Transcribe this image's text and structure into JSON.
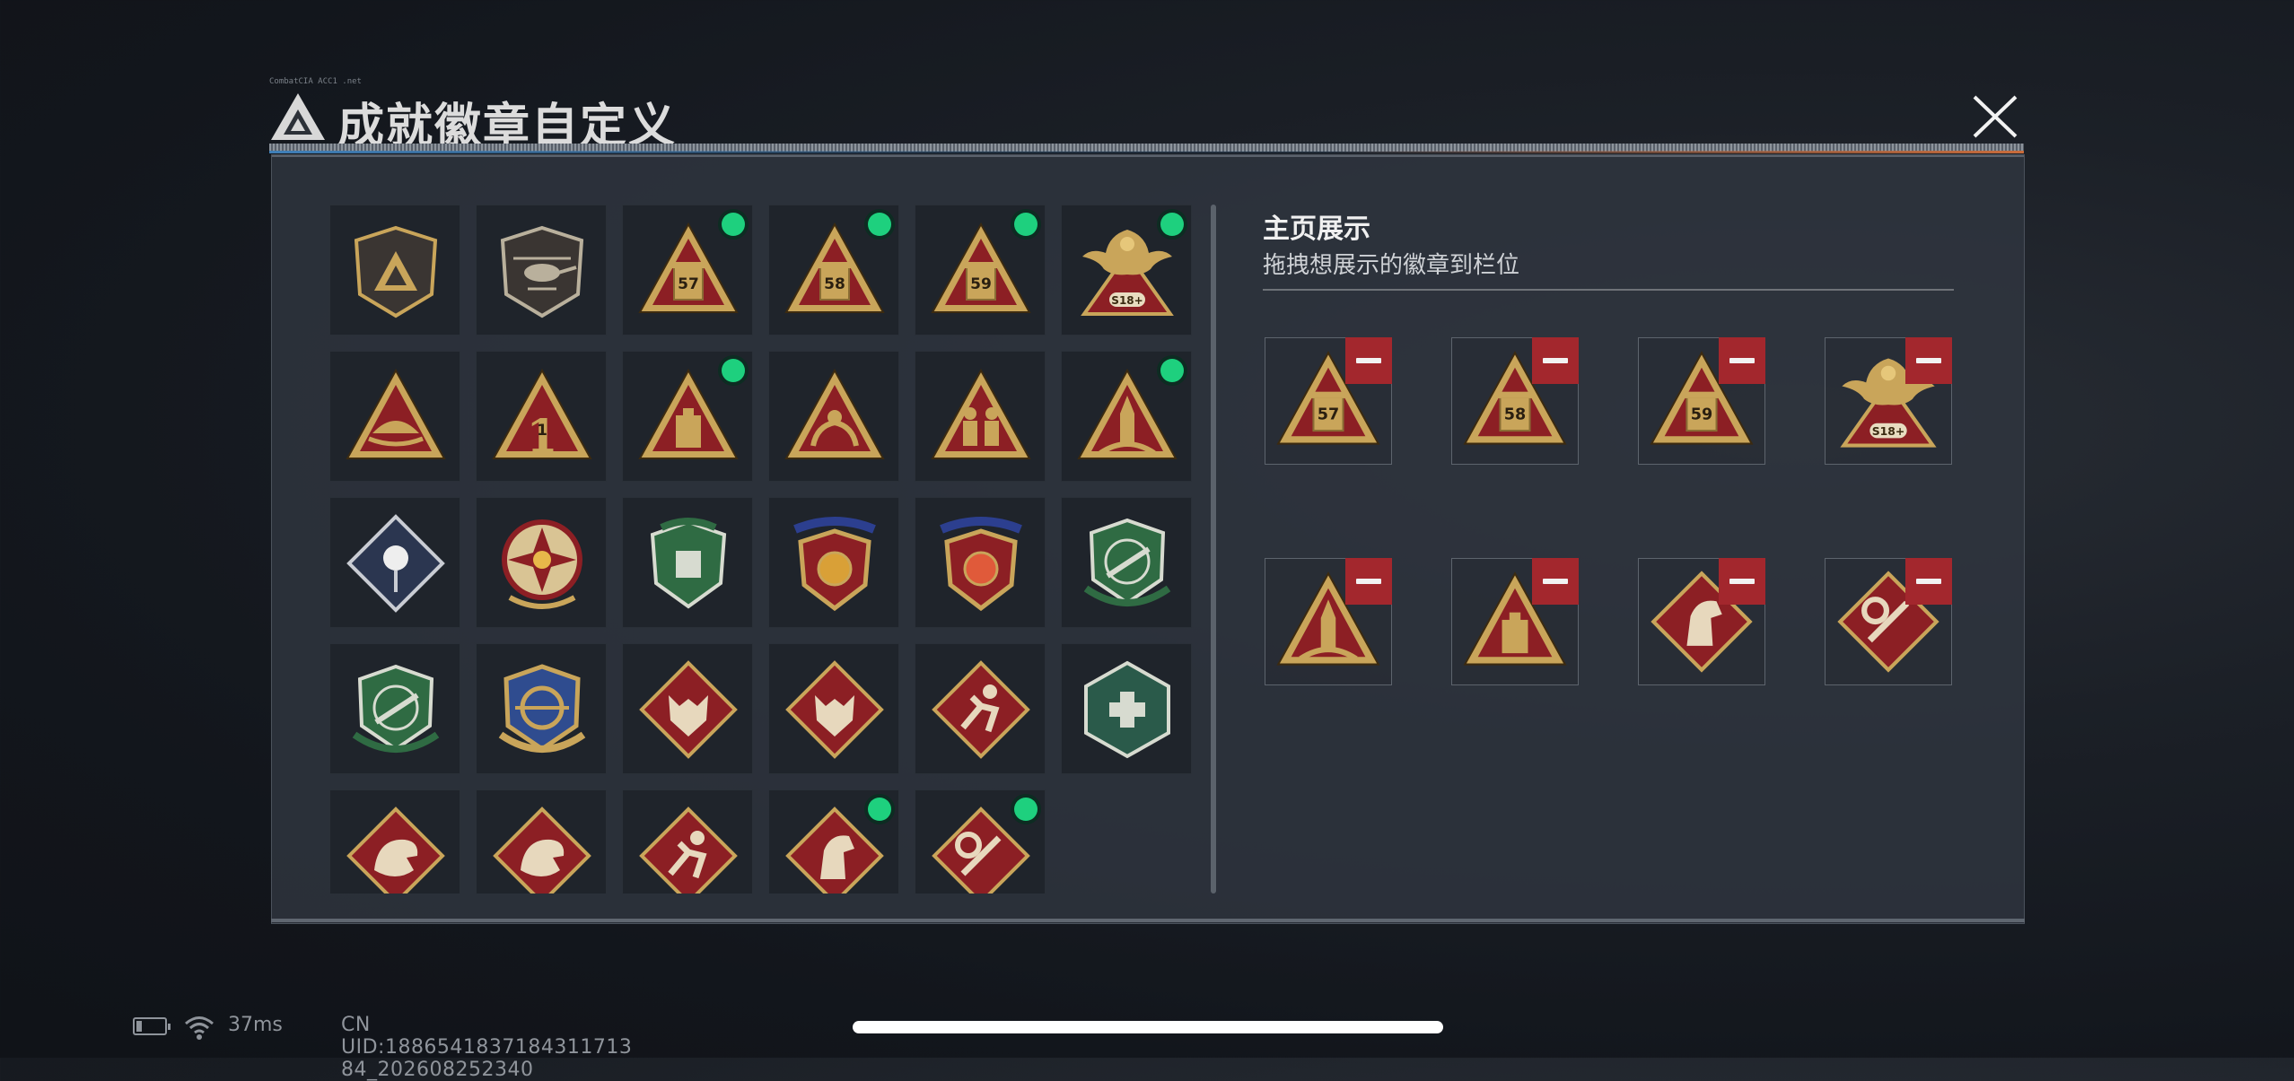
{
  "window": {
    "title": "成就徽章自定义",
    "tiny_caption": "CombatCIA ACC1 .net"
  },
  "showcase": {
    "heading": "主页展示",
    "subtitle": "拖拽想展示的徽章到栏位"
  },
  "colors": {
    "accent_green": "#1ed07e",
    "remove_red": "#a3272d",
    "gold": "#c9a55a",
    "crimson": "#8c1f24"
  },
  "badges": [
    {
      "icon": "shield-logo-icon",
      "new": false
    },
    {
      "icon": "helicopter-shield-icon",
      "new": false
    },
    {
      "icon": "tri-57-icon",
      "new": true,
      "label": "57"
    },
    {
      "icon": "tri-58-icon",
      "new": true,
      "label": "58"
    },
    {
      "icon": "tri-59-icon",
      "new": true,
      "label": "59"
    },
    {
      "icon": "phoenix-s18-icon",
      "new": true,
      "label": "S18+"
    },
    {
      "icon": "tri-helmet-icon",
      "new": false
    },
    {
      "icon": "tri-number-one-icon",
      "new": false,
      "label": "1"
    },
    {
      "icon": "tri-box-icon",
      "new": true
    },
    {
      "icon": "tri-hands-icon",
      "new": false
    },
    {
      "icon": "tri-soldiers-icon",
      "new": false
    },
    {
      "icon": "tri-rocket-icon",
      "new": true
    },
    {
      "icon": "diamond-rose-icon",
      "new": false
    },
    {
      "icon": "star-compass-icon",
      "new": false
    },
    {
      "icon": "green-shield-icon",
      "new": false
    },
    {
      "icon": "star-shield-icon",
      "new": false
    },
    {
      "icon": "star-shield-gem-icon",
      "new": false
    },
    {
      "icon": "green-rifle-icon",
      "new": false
    },
    {
      "icon": "green-smg-icon",
      "new": false
    },
    {
      "icon": "gold-crosshair-icon",
      "new": false
    },
    {
      "icon": "diamond-wolf-icon",
      "new": false
    },
    {
      "icon": "diamond-wolf-icon",
      "new": false
    },
    {
      "icon": "diamond-runner-icon",
      "new": false
    },
    {
      "icon": "hex-medic-icon",
      "new": false
    },
    {
      "icon": "diamond-dragon-icon",
      "new": false
    },
    {
      "icon": "diamond-dragon-icon",
      "new": false
    },
    {
      "icon": "diamond-runner-icon",
      "new": false
    },
    {
      "icon": "diamond-horse-icon",
      "new": true
    },
    {
      "icon": "diamond-tools-icon",
      "new": true
    }
  ],
  "slots": [
    {
      "icon": "tri-57-icon",
      "label": "57"
    },
    {
      "icon": "tri-58-icon",
      "label": "58"
    },
    {
      "icon": "tri-59-icon",
      "label": "59"
    },
    {
      "icon": "phoenix-s18-icon",
      "label": "S18+"
    },
    {
      "icon": "tri-rocket-icon"
    },
    {
      "icon": "tri-box-icon"
    },
    {
      "icon": "diamond-horse-icon"
    },
    {
      "icon": "diamond-tools-icon"
    }
  ],
  "status_bar": {
    "ping": "37ms",
    "uid": "CN UID:1886541837184311713​84_202608252340"
  }
}
